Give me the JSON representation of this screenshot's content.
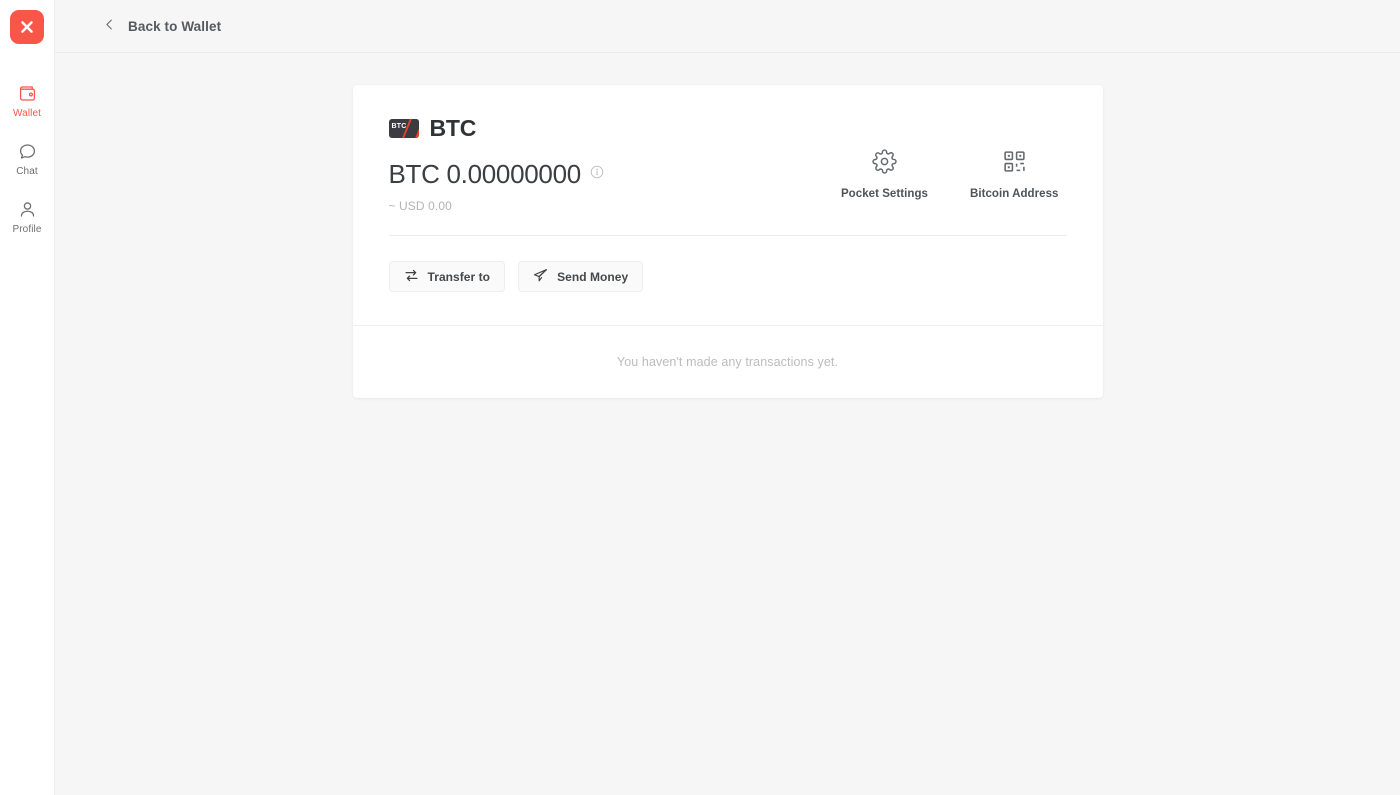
{
  "sidebar": {
    "logo": {
      "icon": "close-x-logo-icon",
      "color": "#f9564a"
    },
    "items": [
      {
        "label": "Wallet",
        "icon": "wallet-icon",
        "active": true
      },
      {
        "label": "Chat",
        "icon": "chat-bubble-icon",
        "active": false
      },
      {
        "label": "Profile",
        "icon": "user-profile-icon",
        "active": false
      }
    ]
  },
  "topbar": {
    "back_label": "Back to Wallet",
    "back_icon": "chevron-left-icon"
  },
  "card": {
    "asset": {
      "badge_text": "BTC",
      "name": "BTC",
      "balance": "BTC 0.00000000",
      "balance_info_icon": "info-circle-icon",
      "fiat_value": "~ USD 0.00"
    },
    "actions": [
      {
        "label": "Pocket Settings",
        "icon": "gear-icon"
      },
      {
        "label": "Bitcoin Address",
        "icon": "qr-code-icon"
      }
    ],
    "buttons": [
      {
        "label": "Transfer to",
        "icon": "transfer-arrows-icon"
      },
      {
        "label": "Send Money",
        "icon": "paper-plane-icon"
      }
    ],
    "empty_state": "You haven't made any transactions yet."
  },
  "colors": {
    "brand": "#f9564a",
    "page_bg": "#f6f6f6",
    "card_bg": "#ffffff",
    "text": "#3c3c3c",
    "muted": "#bcbcbc"
  }
}
